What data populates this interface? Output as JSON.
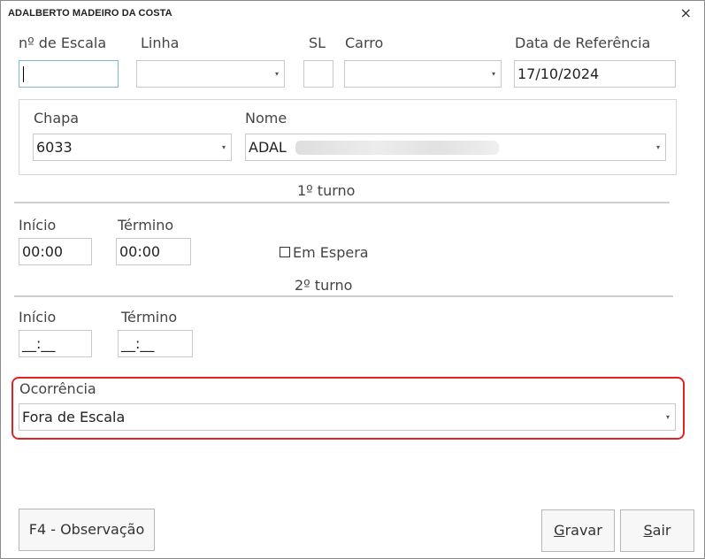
{
  "window": {
    "title": "ADALBERTO MADEIRO DA COSTA",
    "close_glyph": "×"
  },
  "labels": {
    "escala": "nº de Escala",
    "linha": "Linha",
    "sl": "SL",
    "carro": "Carro",
    "data_ref": "Data de Referência",
    "chapa": "Chapa",
    "nome": "Nome",
    "turno1": "1º turno",
    "turno2": "2º turno",
    "inicio1": "Início",
    "termino1": "Término",
    "inicio2": "Início",
    "termino2": "Término",
    "em_espera": "Em Espera",
    "ocorrencia": "Ocorrência"
  },
  "values": {
    "escala": "",
    "linha": "",
    "sl": "",
    "carro": "",
    "data_ref": "17/10/2024",
    "chapa": "6033",
    "nome": "ADAL",
    "inicio1": "00:00",
    "termino1": "00:00",
    "inicio2": "__:__",
    "termino2": "__:__",
    "em_espera_checked": false,
    "ocorrencia": "Fora de Escala"
  },
  "buttons": {
    "observacao": "F4 - Observação",
    "gravar_first": "G",
    "gravar_rest": "ravar",
    "sair_first": "S",
    "sair_rest": "air"
  },
  "icons": {
    "dropdown": "▾"
  },
  "colors": {
    "highlight": "#e02424",
    "focus_border": "#7fb4de"
  }
}
